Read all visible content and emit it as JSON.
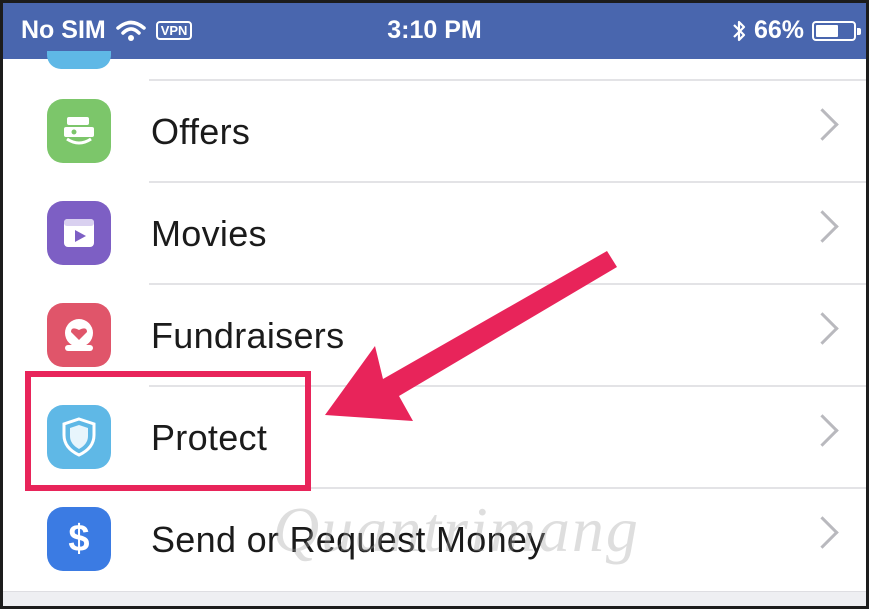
{
  "status_bar": {
    "carrier": "No SIM",
    "vpn_label": "VPN",
    "time": "3:10 PM",
    "battery_percent_text": "66%",
    "battery_level": 0.66
  },
  "list": {
    "items": [
      {
        "label": "Offers",
        "icon": "offers-icon",
        "color": "#7cc66a"
      },
      {
        "label": "Movies",
        "icon": "movies-icon",
        "color": "#7d5fc4"
      },
      {
        "label": "Fundraisers",
        "icon": "fundraisers-icon",
        "color": "#e0556a"
      },
      {
        "label": "Protect",
        "icon": "shield-icon",
        "color": "#5fb8e6"
      },
      {
        "label": "Send or Request Money",
        "icon": "dollar-icon",
        "color": "#3b7be3"
      }
    ]
  },
  "colors": {
    "status_bar": "#4966ae",
    "annotation": "#e8245a"
  },
  "watermark": "Quantrimang"
}
